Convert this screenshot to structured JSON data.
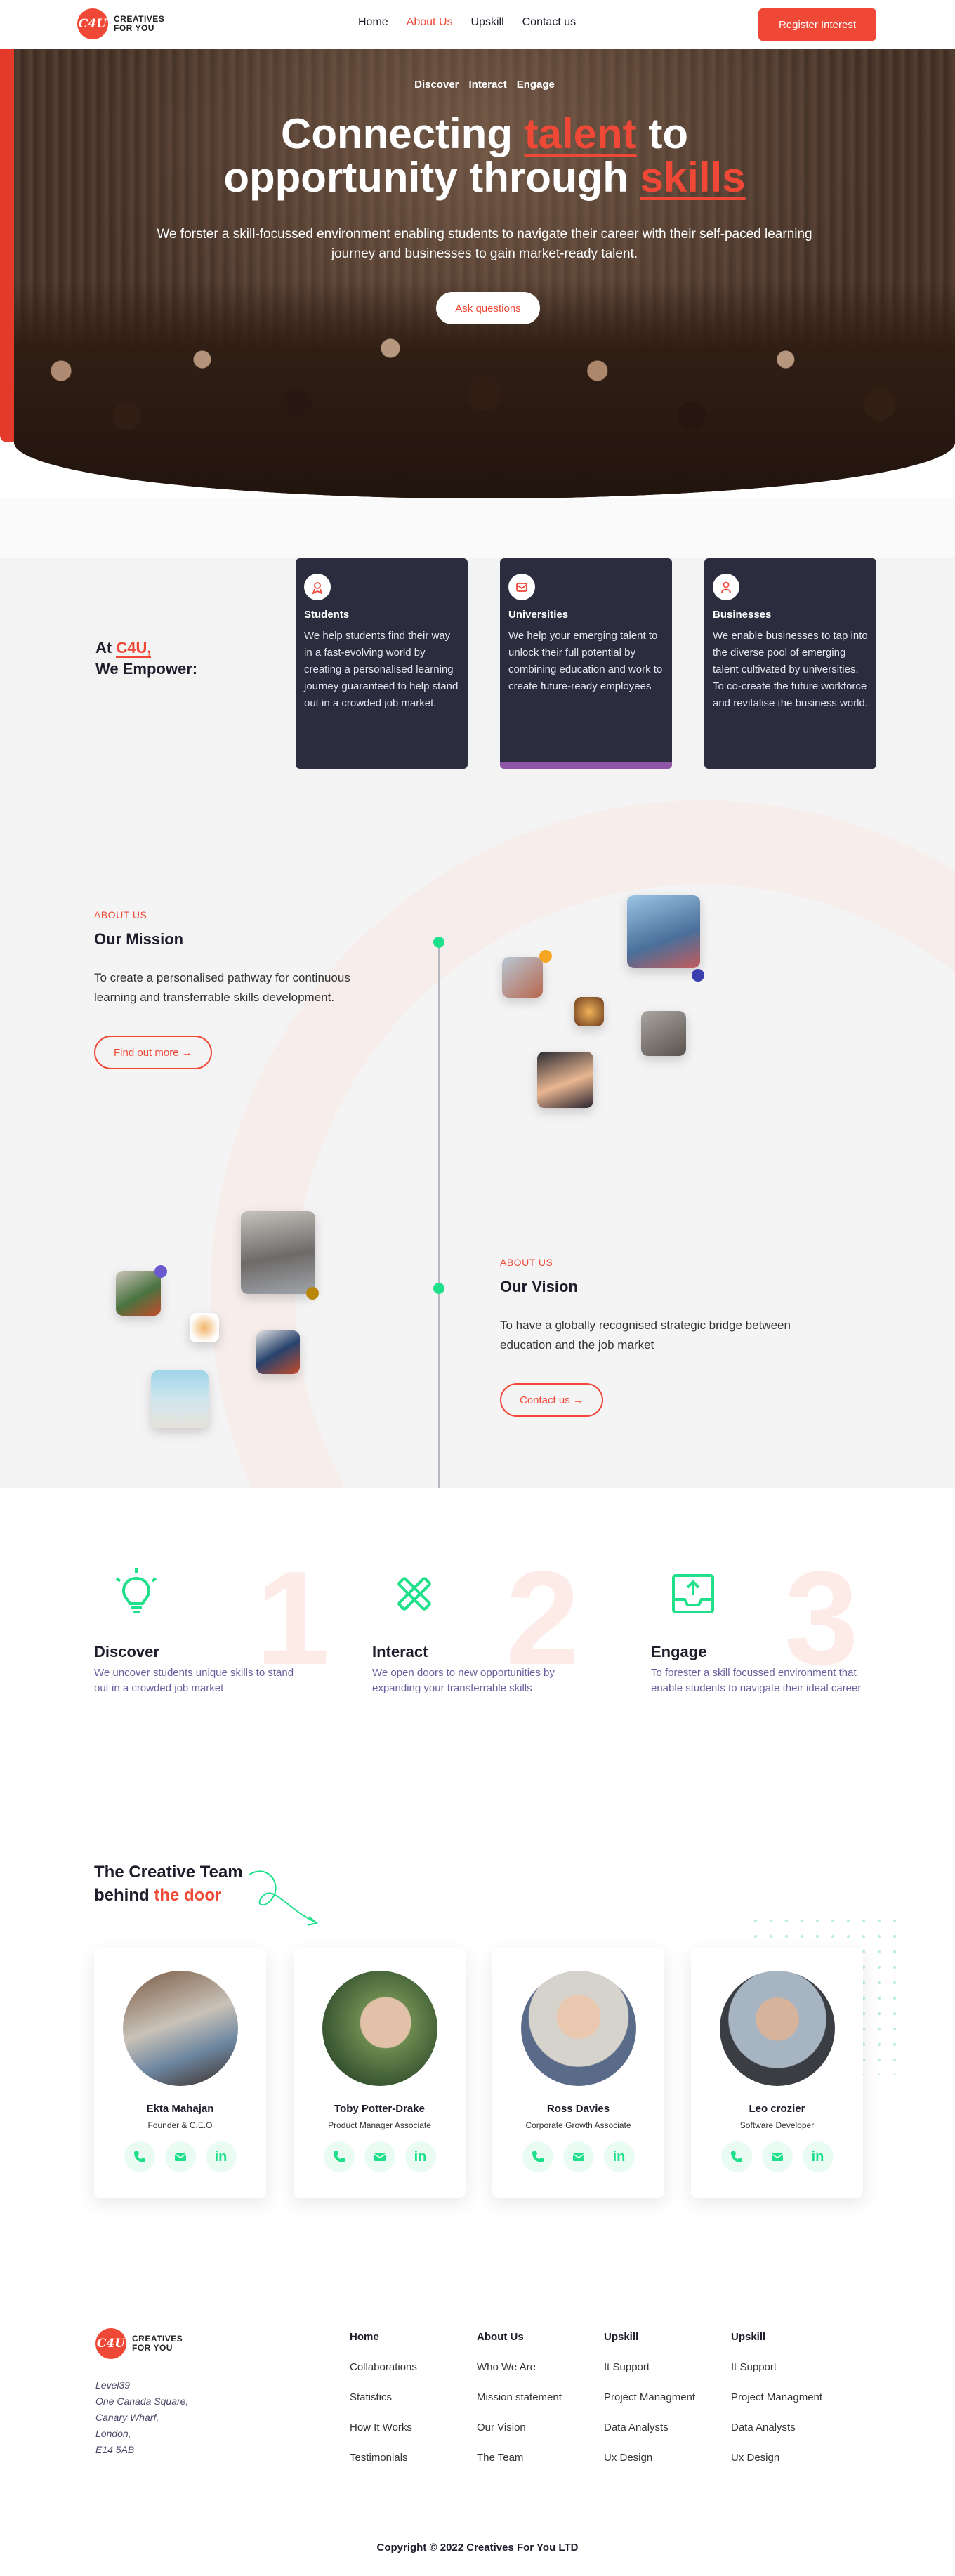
{
  "nav": {
    "logo_badge": "C4U",
    "logo_line1": "CREATIVES",
    "logo_line2": "FOR YOU",
    "links": [
      "Home",
      "About Us",
      "Upskill",
      "Contact us"
    ],
    "active": "About Us",
    "cta": "Register Interest"
  },
  "hero": {
    "tags": [
      "Discover",
      "Interact",
      "Engage"
    ],
    "title_a": "Connecting ",
    "title_hl1": "talent",
    "title_b": " to",
    "title_c": "opportunity through ",
    "title_hl2": "skills",
    "subtitle": "We forster a skill-focussed environment enabling students to navigate their career with their self-paced learning journey and businesses to gain market-ready talent.",
    "button": "Ask questions"
  },
  "empower": {
    "title_prefix": "At ",
    "title_accent": "C4U,",
    "title_line2": "We Empower:",
    "cards": [
      {
        "icon": "graduate-icon",
        "title": "Students",
        "text": "We help students find their way in a fast-evolving world by creating a personalised learning journey guaranteed to help stand out in a crowded job market."
      },
      {
        "icon": "mail-icon",
        "title": "Universities",
        "text": "We help your emerging talent to unlock their full potential by combining education and work to create future-ready employees"
      },
      {
        "icon": "user-icon",
        "title": "Businesses",
        "text": "We enable businesses to tap into the diverse pool of emerging talent cultivated by universities. To co-create the future workforce and revitalise the business world."
      }
    ],
    "accent_bar_color": "#8f55a8"
  },
  "mission": {
    "eyebrow": "ABOUT US",
    "title": "Our Mission",
    "text": "To create a personalised pathway for continuous learning and transferrable skills development.",
    "button": "Find out more →"
  },
  "vision": {
    "eyebrow": "ABOUT US",
    "title": "Our Vision",
    "text": "To have a globally recognised strategic bridge between education and the job market",
    "button": "Contact us →"
  },
  "steps": [
    {
      "number": "1",
      "icon": "lightbulb-icon",
      "title": "Discover",
      "text": "We uncover students unique skills to stand out in a crowded job market"
    },
    {
      "number": "2",
      "icon": "tools-icon",
      "title": "Interact",
      "text": "We open doors to new opportunities by expanding your transferrable skills"
    },
    {
      "number": "3",
      "icon": "upload-tray-icon",
      "title": "Engage",
      "text": "To forester a skill focussed environment that enable students to navigate their ideal career"
    }
  ],
  "team": {
    "title_line1": "The Creative Team",
    "title_prefix": "behind ",
    "title_accent": "the door",
    "members": [
      {
        "name": "Ekta Mahajan",
        "role": "Founder & C.E.O"
      },
      {
        "name": "Toby Potter-Drake",
        "role": "Product Manager Associate"
      },
      {
        "name": "Ross Davies",
        "role": "Corporate Growth Associate"
      },
      {
        "name": "Leo crozier",
        "role": "Software Developer"
      }
    ],
    "social_icons": [
      "phone-icon",
      "mail-icon",
      "linkedin-icon"
    ],
    "social_linkedin": "in"
  },
  "footer": {
    "logo_badge": "C4U",
    "logo_line1": "CREATIVES",
    "logo_line2": "FOR YOU",
    "address": [
      "Level39",
      "One Canada Square,",
      "Canary Wharf,",
      "London,",
      "E14 5AB"
    ],
    "columns": [
      {
        "title": "Home",
        "links": [
          "Collaborations",
          "Statistics",
          "How It Works",
          "Testimonials"
        ]
      },
      {
        "title": "About Us",
        "links": [
          "Who We Are",
          "Mission statement",
          "Our Vision",
          "The Team"
        ]
      },
      {
        "title": "Upskill",
        "links": [
          "It Support",
          "Project Managment",
          "Data Analysts",
          "Ux Design"
        ]
      },
      {
        "title": "Upskill",
        "links": [
          "It Support",
          "Project Managment",
          "Data Analysts",
          "Ux Design"
        ]
      }
    ],
    "copyright": "Copyright © 2022 Creatives For You LTD"
  },
  "colors": {
    "accent": "#ef4836",
    "dark_card": "#2b2c3e",
    "green": "#1fe08a",
    "purple_text": "#6a5f9e"
  }
}
